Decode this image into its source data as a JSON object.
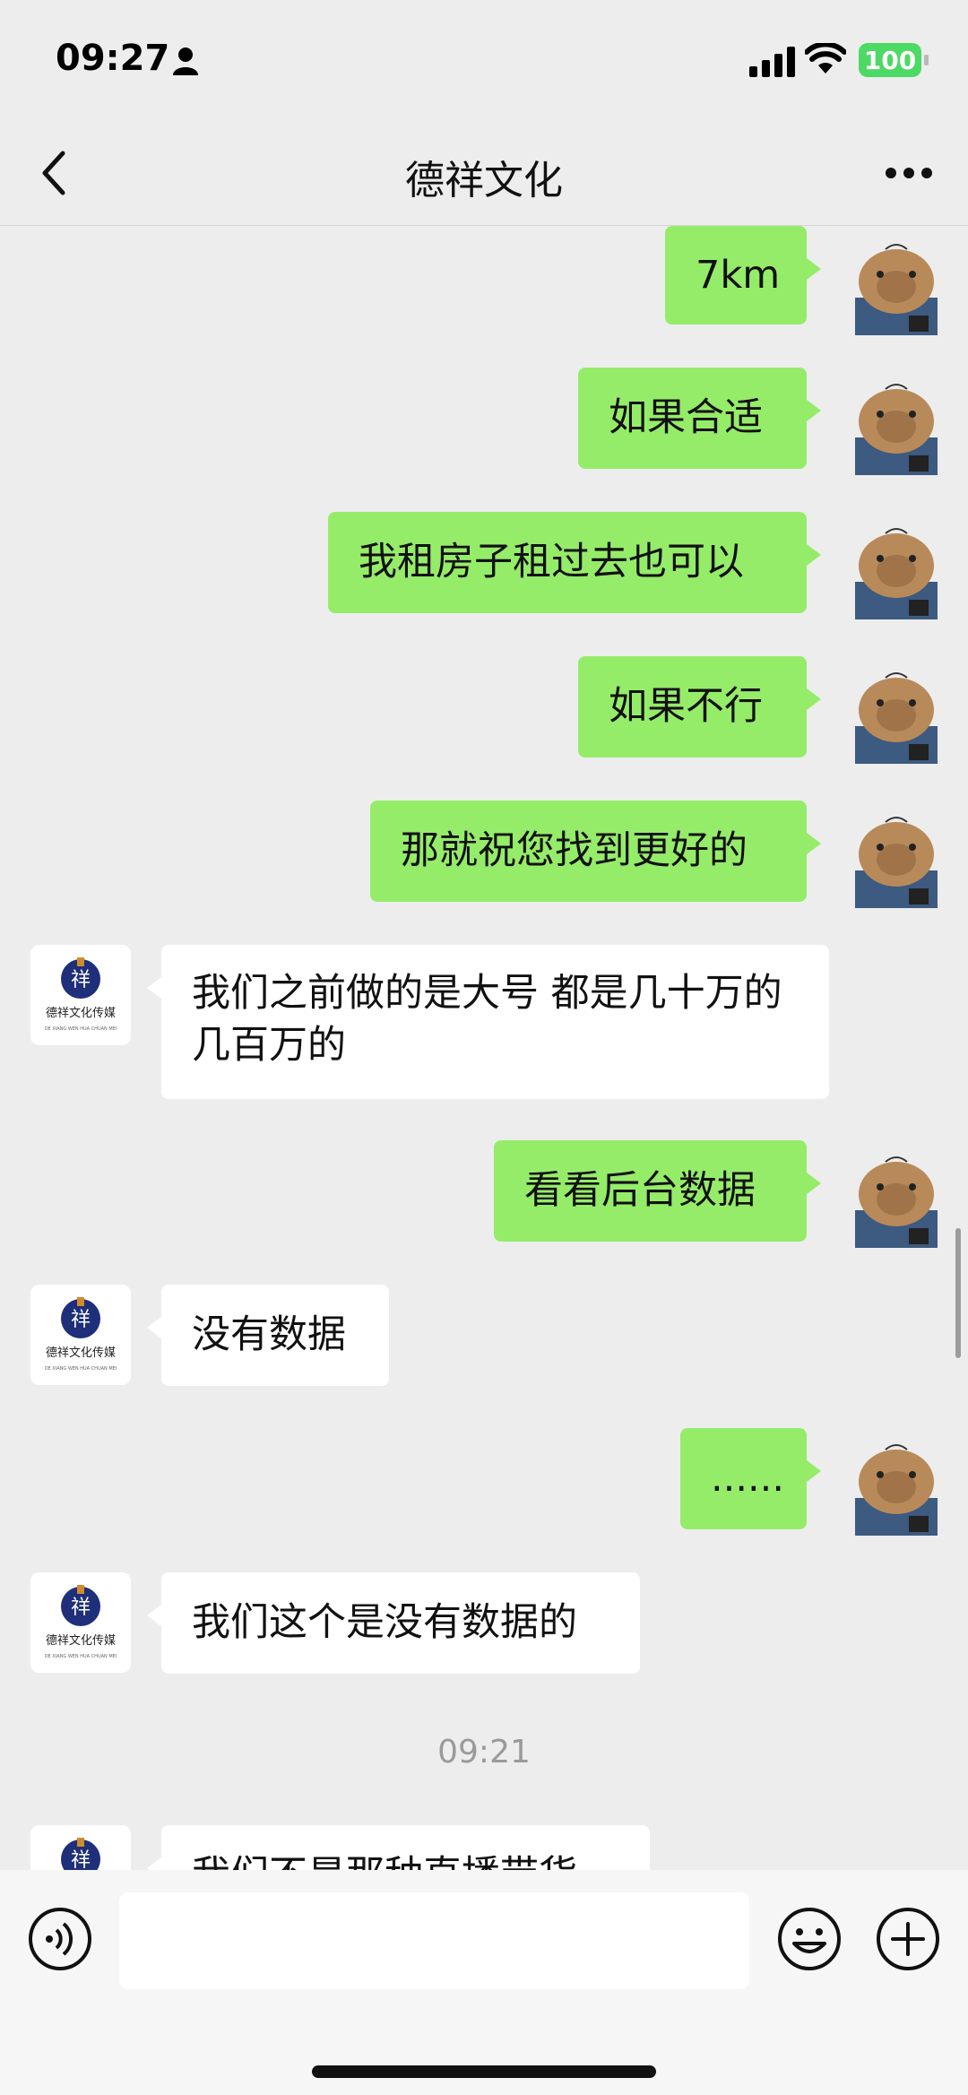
{
  "status": {
    "time": "09:27",
    "battery": "100"
  },
  "header": {
    "title": "德祥文化"
  },
  "messages": [
    {
      "text": "7km"
    },
    {
      "text": "如果合适"
    },
    {
      "text": "我租房子租过去也可以"
    },
    {
      "text": "如果不行"
    },
    {
      "text": "那就祝您找到更好的"
    },
    {
      "text": "我们之前做的是大号  都是几十万的 几百万的"
    },
    {
      "text": "看看后台数据"
    },
    {
      "text": "没有数据"
    },
    {
      "text": "......"
    },
    {
      "text": "我们这个是没有数据的"
    },
    {
      "text": "我们不是那种直播带货"
    }
  ],
  "timestamp": "09:21",
  "contact_logo": {
    "text": "德祥文化传媒",
    "subtext": "DE XIANG WEN HUA CHUAN MEI"
  },
  "colors": {
    "outgoing": "#95ec69",
    "incoming": "#ffffff",
    "background": "#ededed"
  }
}
